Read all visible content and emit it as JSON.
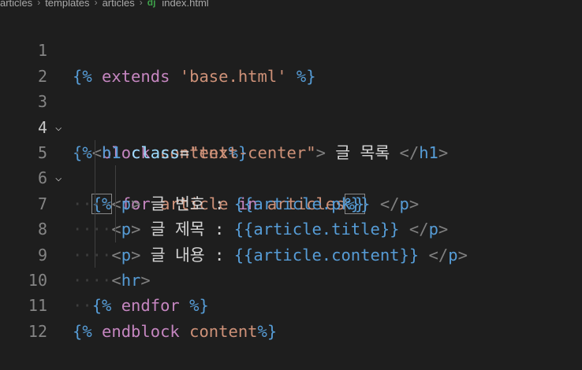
{
  "breadcrumb": {
    "items": [
      "articles",
      "templates",
      "articles",
      "index.html"
    ],
    "file_icon": "dj"
  },
  "editor": {
    "active_line": 4,
    "lines": [
      {
        "n": "1"
      },
      {
        "n": "2"
      },
      {
        "n": "3"
      },
      {
        "n": "4"
      },
      {
        "n": "5"
      },
      {
        "n": "6"
      },
      {
        "n": "7"
      },
      {
        "n": "8"
      },
      {
        "n": "9"
      },
      {
        "n": "10"
      },
      {
        "n": "11"
      },
      {
        "n": "12"
      }
    ],
    "tokens": {
      "l1": [
        "{%",
        " ",
        "extends",
        " ",
        "'base.html'",
        " ",
        "%}"
      ],
      "l3": [
        "{%",
        " ",
        "block",
        " ",
        "content",
        "%}"
      ],
      "l4": [
        "<",
        "h1",
        " ",
        "class",
        "=",
        "\"text-center\"",
        ">",
        " 글 목록 ",
        "</",
        "h1",
        ">"
      ],
      "l5": [
        "{%",
        " ",
        "for",
        " ",
        "article",
        " ",
        "in",
        " ",
        "articles",
        "%}"
      ],
      "l6": [
        "<",
        "p",
        ">",
        " 글 번호 : ",
        "{{article.pk}}",
        " ",
        "</",
        "p",
        ">"
      ],
      "l7": [
        "<",
        "p",
        ">",
        " 글 제목 : ",
        "{{article.title}}",
        " ",
        "</",
        "p",
        ">"
      ],
      "l8": [
        "<",
        "p",
        ">",
        " 글 내용 : ",
        "{{article.content}}",
        " ",
        "</",
        "p",
        ">"
      ],
      "l9": [
        "<",
        "hr",
        ">"
      ],
      "l10": [
        "{%",
        " ",
        "endfor",
        " ",
        "%}"
      ],
      "l11": [
        "{%",
        " ",
        "endblock",
        " ",
        "content",
        "%}"
      ]
    }
  }
}
